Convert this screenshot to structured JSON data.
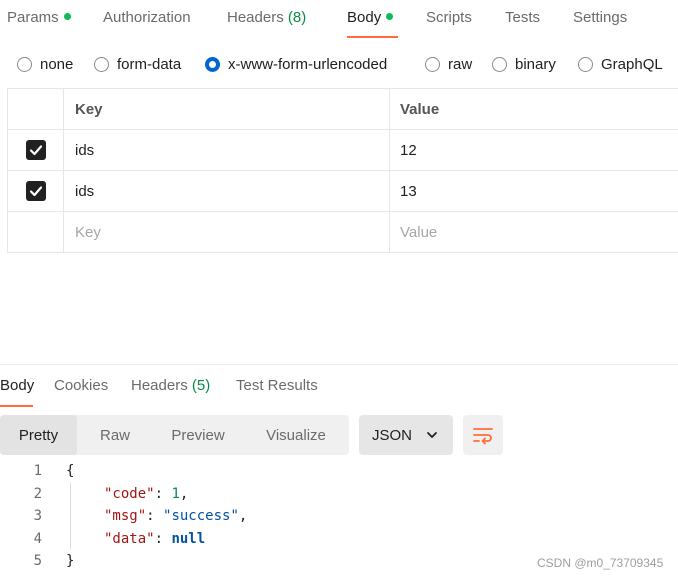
{
  "request_tabs": {
    "params": "Params",
    "authorization": "Authorization",
    "headers": "Headers",
    "headers_count": "(8)",
    "body": "Body",
    "scripts": "Scripts",
    "tests": "Tests",
    "settings": "Settings",
    "active": "Body"
  },
  "body_types": {
    "none": "none",
    "form_data": "form-data",
    "urlencoded": "x-www-form-urlencoded",
    "raw": "raw",
    "binary": "binary",
    "graphql": "GraphQL",
    "selected": "x-www-form-urlencoded"
  },
  "kv_table": {
    "header_key": "Key",
    "header_value": "Value",
    "rows": [
      {
        "key": "ids",
        "value": "12",
        "checked": true
      },
      {
        "key": "ids",
        "value": "13",
        "checked": true
      }
    ],
    "placeholder_key": "Key",
    "placeholder_value": "Value"
  },
  "response_tabs": {
    "body": "Body",
    "cookies": "Cookies",
    "headers": "Headers",
    "headers_count": "(5)",
    "test_results": "Test Results",
    "active": "Body"
  },
  "response_view": {
    "pretty": "Pretty",
    "raw": "Raw",
    "preview": "Preview",
    "visualize": "Visualize",
    "active": "Pretty",
    "language": "JSON"
  },
  "response_code": {
    "line_numbers": [
      "1",
      "2",
      "3",
      "4",
      "5"
    ],
    "open_brace": "{",
    "close_brace": "}",
    "code_key": "\"code\"",
    "code_value": "1",
    "msg_key": "\"msg\"",
    "msg_value": "\"success\"",
    "data_key": "\"data\"",
    "data_value": "null",
    "colon": ": ",
    "comma": ","
  },
  "watermark": "CSDN @m0_73709345",
  "colors": {
    "accent_orange": "#ff6c37",
    "radio_blue": "#0265d2",
    "status_green": "#0cbb52"
  }
}
